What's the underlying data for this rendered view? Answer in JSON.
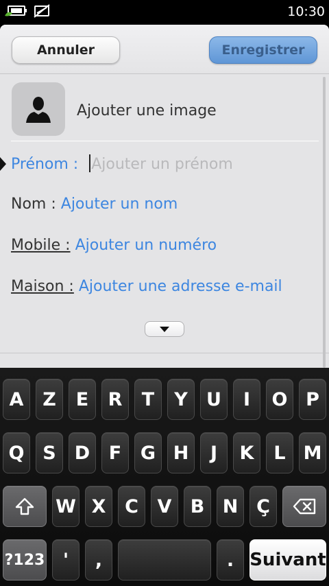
{
  "status_bar": {
    "time": "10:30",
    "icons": [
      "battery-charging-icon",
      "no-signal-icon"
    ]
  },
  "toolbar": {
    "cancel_label": "Annuler",
    "save_label": "Enregistrer"
  },
  "contact": {
    "add_image_label": "Ajouter une image",
    "fields": [
      {
        "label": "Prénom :",
        "placeholder": "Ajouter un prénom",
        "active": true
      },
      {
        "label": "Nom :",
        "placeholder": "Ajouter un nom"
      },
      {
        "label": "Mobile :",
        "placeholder": "Ajouter un numéro"
      },
      {
        "label": "Maison :",
        "placeholder": "Ajouter une adresse e-mail"
      }
    ]
  },
  "keyboard": {
    "row1": [
      "A",
      "Z",
      "E",
      "R",
      "T",
      "Y",
      "U",
      "I",
      "O",
      "P"
    ],
    "row2": [
      "Q",
      "S",
      "D",
      "F",
      "G",
      "H",
      "J",
      "K",
      "L",
      "M"
    ],
    "row3": [
      "W",
      "X",
      "C",
      "V",
      "B",
      "N",
      "Ç"
    ],
    "numbers_label": "?123",
    "apostrophe": "'",
    "comma": ",",
    "period": ".",
    "next_label": "Suivant"
  }
}
